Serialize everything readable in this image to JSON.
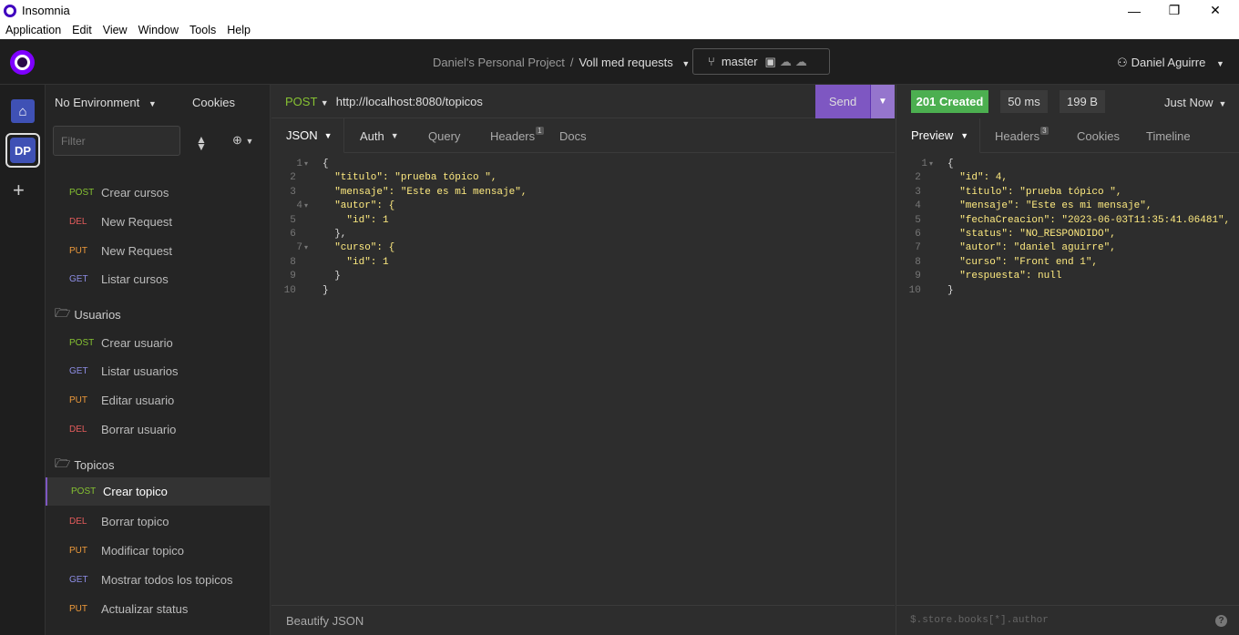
{
  "window": {
    "app_name": "Insomnia",
    "minimize": "—",
    "maximize": "❐",
    "close": "✕"
  },
  "menu": [
    "Application",
    "Edit",
    "View",
    "Window",
    "Tools",
    "Help"
  ],
  "header": {
    "project": "Daniel's Personal Project",
    "separator": "/",
    "collection": "Voll med requests",
    "branch": "master",
    "user": "Daniel Aguirre"
  },
  "iconbar": {
    "workspace_initials": "DP"
  },
  "sidebar": {
    "environment": "No Environment",
    "cookies": "Cookies",
    "filter_placeholder": "Filter",
    "requests_top": [
      {
        "method": "POST",
        "name": "Crear cursos"
      },
      {
        "method": "DEL",
        "name": "New Request"
      },
      {
        "method": "PUT",
        "name": "New Request"
      },
      {
        "method": "GET",
        "name": "Listar cursos"
      }
    ],
    "folders": [
      {
        "name": "Usuarios",
        "requests": [
          {
            "method": "POST",
            "name": "Crear usuario"
          },
          {
            "method": "GET",
            "name": "Listar usuarios"
          },
          {
            "method": "PUT",
            "name": "Editar usuario"
          },
          {
            "method": "DEL",
            "name": "Borrar usuario"
          }
        ]
      },
      {
        "name": "Topicos",
        "requests": [
          {
            "method": "POST",
            "name": "Crear topico"
          },
          {
            "method": "DEL",
            "name": "Borrar topico"
          },
          {
            "method": "PUT",
            "name": "Modificar topico"
          },
          {
            "method": "GET",
            "name": "Mostrar todos los topicos"
          },
          {
            "method": "PUT",
            "name": "Actualizar status"
          }
        ]
      }
    ]
  },
  "request": {
    "method": "POST",
    "url": "http://localhost:8080/topicos",
    "send": "Send",
    "tabs": {
      "body": "JSON",
      "auth": "Auth",
      "query": "Query",
      "headers": "Headers",
      "headers_count": "1",
      "docs": "Docs"
    },
    "body_lines": [
      "{",
      "  \"titulo\": \"prueba tópico \",",
      "  \"mensaje\": \"Este es mi mensaje\",",
      "  \"autor\": {",
      "    \"id\": 1",
      "  },",
      "  \"curso\": {",
      "    \"id\": 1",
      "  }",
      "}"
    ],
    "beautify": "Beautify JSON"
  },
  "response": {
    "status": "201 Created",
    "time": "50 ms",
    "size": "199 B",
    "when": "Just Now",
    "tabs": {
      "preview": "Preview",
      "headers": "Headers",
      "headers_count": "3",
      "cookies": "Cookies",
      "timeline": "Timeline"
    },
    "body_lines": [
      "{",
      "  \"id\": 4,",
      "  \"titulo\": \"prueba tópico \",",
      "  \"mensaje\": \"Este es mi mensaje\",",
      "  \"fechaCreacion\": \"2023-06-03T11:35:41.06481\",",
      "  \"status\": \"NO_RESPONDIDO\",",
      "  \"autor\": \"daniel aguirre\",",
      "  \"curso\": \"Front end 1\",",
      "  \"respuesta\": null",
      "}"
    ],
    "filter_placeholder": "$.store.books[*].author",
    "help": "?"
  },
  "colors": {
    "post": "#86c232",
    "del": "#e55c5c",
    "put": "#ee9a3a",
    "get": "#8e8ee6",
    "accent": "#7e57c2",
    "status_ok": "#4caf50"
  }
}
